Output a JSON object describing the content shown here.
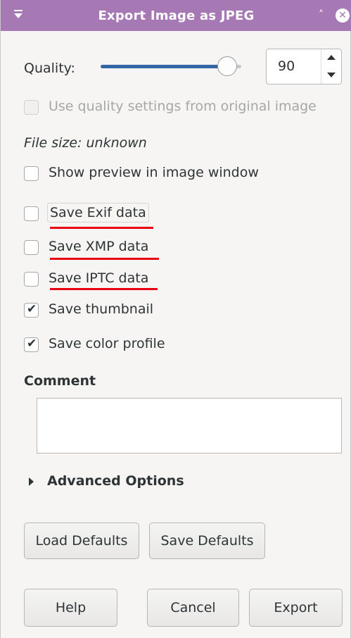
{
  "window": {
    "title": "Export Image as JPEG"
  },
  "quality": {
    "label": "Quality:",
    "value": "90",
    "slider_fraction": 0.9
  },
  "use_original_quality": {
    "label": "Use quality settings from original image",
    "checked": false,
    "enabled": false
  },
  "file_size": "File size: unknown",
  "options": [
    {
      "label": "Show preview in image window",
      "checked": false
    },
    {
      "label": "Save Exif data",
      "checked": false
    },
    {
      "label": "Save XMP data",
      "checked": false
    },
    {
      "label": "Save IPTC data",
      "checked": false
    },
    {
      "label": "Save thumbnail",
      "checked": true
    },
    {
      "label": "Save color profile",
      "checked": true
    }
  ],
  "comment": {
    "title": "Comment",
    "value": ""
  },
  "advanced": {
    "label": "Advanced Options",
    "expanded": false
  },
  "buttons": {
    "load_defaults": "Load Defaults",
    "save_defaults": "Save Defaults",
    "help": "Help",
    "cancel": "Cancel",
    "export": "Export"
  },
  "colors": {
    "titlebar": "#a679b5",
    "slider_fill": "#3465a4",
    "annotation_underline": "#e8000e"
  },
  "icons": {
    "window_menu": "window-menu-icon",
    "shade": "chevron-up-icon",
    "close": "close-icon",
    "spin_up": "spin-up-icon",
    "spin_down": "spin-down-icon",
    "expander": "expander-arrow-icon"
  }
}
